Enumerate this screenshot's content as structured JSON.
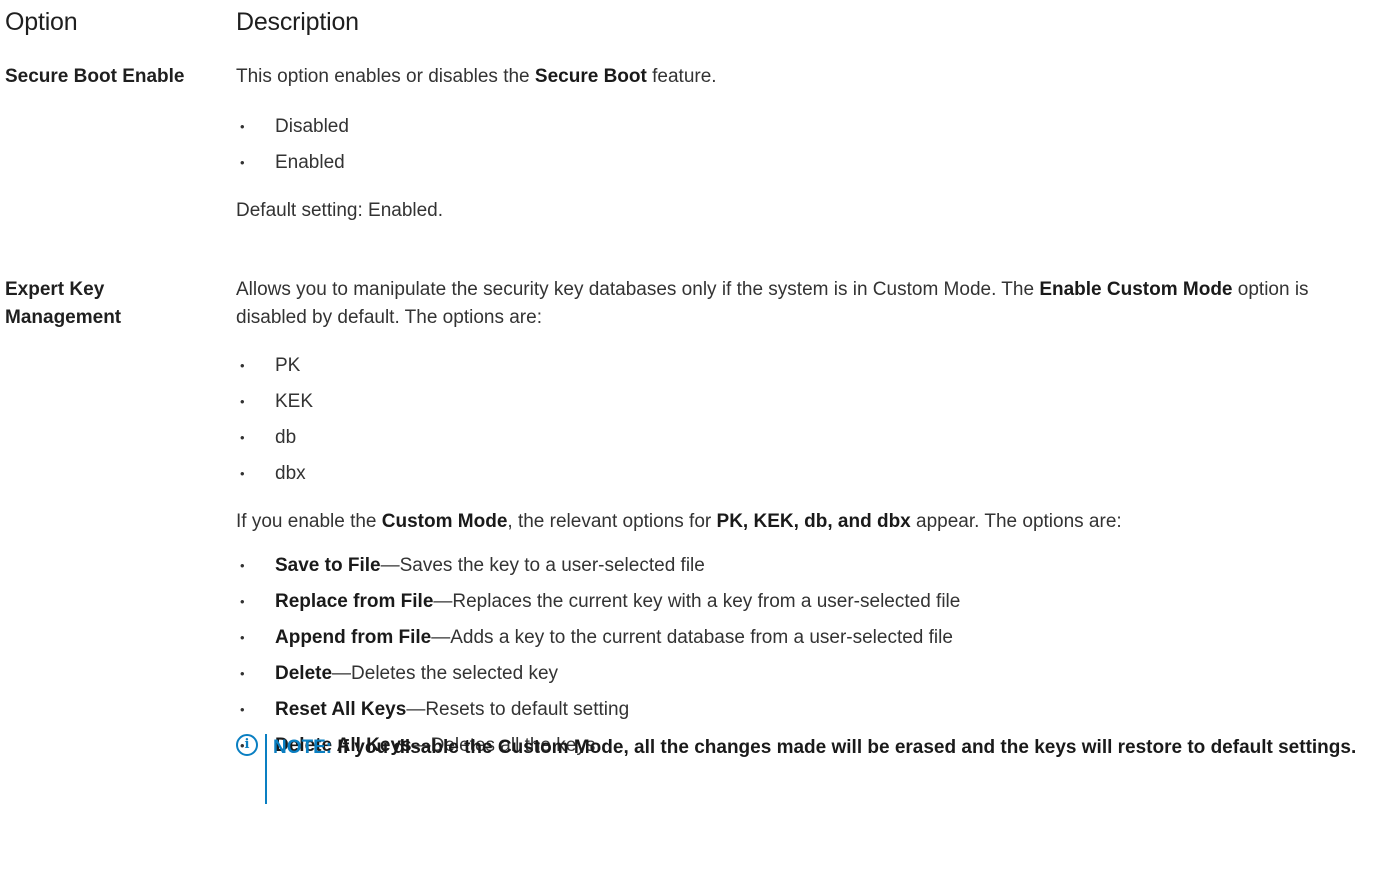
{
  "header": {
    "option": "Option",
    "description": "Description"
  },
  "secure_boot": {
    "label": "Secure Boot Enable",
    "desc_pre": "This option enables or disables the ",
    "desc_bold": "Secure Boot",
    "desc_post": " feature.",
    "options": [
      "Disabled",
      "Enabled"
    ],
    "default": "Default setting: Enabled."
  },
  "expert_key": {
    "label_line1": "Expert Key",
    "label_line2": "Management",
    "intro_pre": "Allows you to manipulate the security key databases only if the system is in Custom Mode. The ",
    "intro_bold": "Enable Custom Mode",
    "intro_post": " option is disabled by default. The options are:",
    "keys": [
      "PK",
      "KEK",
      "db",
      "dbx"
    ],
    "custom_pre": "If you enable the ",
    "custom_bold1": "Custom Mode",
    "custom_mid": ", the relevant options for ",
    "custom_bold2": "PK, KEK, db, and dbx",
    "custom_post": " appear. The options are:",
    "actions": [
      {
        "name": "Save to File",
        "desc": "—Saves the key to a user-selected file"
      },
      {
        "name": "Replace from File",
        "desc": "—Replaces the current key with a key from a user-selected file"
      },
      {
        "name": "Append from File",
        "desc": "—Adds a key to the current database from a user-selected file"
      },
      {
        "name": "Delete",
        "desc": "—Deletes the selected key"
      },
      {
        "name": "Reset All Keys",
        "desc": "—Resets to default setting"
      },
      {
        "name": "Delete All Keys",
        "desc": "—Deletes all the keys"
      }
    ]
  },
  "note": {
    "icon": "info-icon",
    "label": "NOTE:",
    "text": " If you disable the Custom Mode, all the changes made will be erased and the keys will restore to default settings."
  },
  "colors": {
    "accent": "#0a7fc2",
    "text": "#333333"
  }
}
